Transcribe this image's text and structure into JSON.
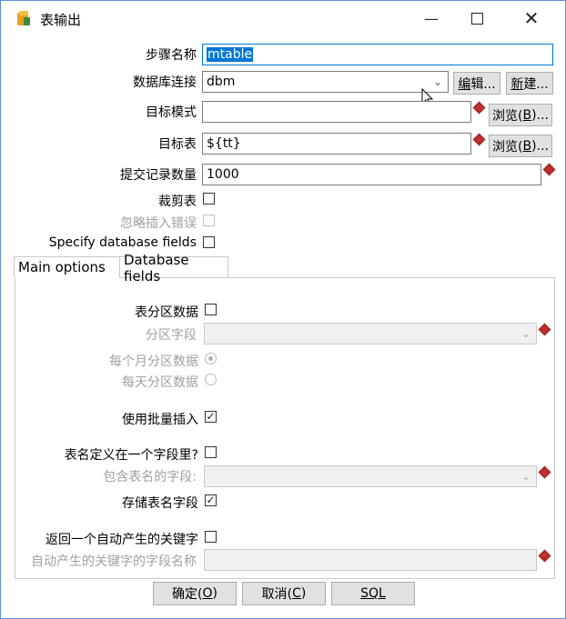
{
  "window": {
    "title": "表输出"
  },
  "fields": {
    "step_name": {
      "label": "步骤名称",
      "value": "mtable"
    },
    "db_conn": {
      "label": "数据库连接",
      "value": "dbm",
      "edit": "编辑...",
      "edit_u": "编",
      "edit_rest": "辑...",
      "new": "新建...",
      "new_u": "新",
      "new_rest": "建..."
    },
    "target_schema": {
      "label": "目标模式",
      "value": "",
      "browse_pre": "浏览(",
      "browse_u": "B",
      "browse_post": ")..."
    },
    "target_table": {
      "label": "目标表",
      "value": "${tt}",
      "browse_pre": "浏览(",
      "browse_u": "B",
      "browse_post": ")..."
    },
    "commit_size": {
      "label": "提交记录数量",
      "value": "1000"
    },
    "truncate": {
      "label": "裁剪表",
      "checked": false
    },
    "ignore_errors": {
      "label": "忽略插入错误",
      "checked": false
    },
    "specify_fields": {
      "label": "Specify database fields",
      "checked": false
    }
  },
  "tabs": [
    {
      "label": "Main options",
      "active": true
    },
    {
      "label": "Database fields",
      "active": false
    }
  ],
  "main_options": {
    "partition": {
      "label": "表分区数据",
      "checked": false
    },
    "partition_field": {
      "label": "分区字段",
      "value": ""
    },
    "monthly": {
      "label": "每个月分区数据",
      "selected": true
    },
    "daily": {
      "label": "每天分区数据",
      "selected": false
    },
    "batch": {
      "label": "使用批量插入",
      "checked": true
    },
    "name_in_field": {
      "label": "表名定义在一个字段里?",
      "checked": false
    },
    "name_field": {
      "label": "包含表名的字段:",
      "value": ""
    },
    "store_name": {
      "label": "存储表名字段",
      "checked": true
    },
    "return_key": {
      "label": "返回一个自动产生的关键字",
      "checked": false
    },
    "key_field": {
      "label": "自动产生的关键字的字段名称",
      "value": ""
    }
  },
  "footer": {
    "ok_pre": "确定(",
    "ok_u": "O",
    "ok_post": ")",
    "cancel_pre": "取消(",
    "cancel_u": "C",
    "cancel_post": ")",
    "sql": "SQL"
  },
  "icons": {
    "minimize": "minimize-icon",
    "maximize": "maximize-icon",
    "close": "close-icon"
  },
  "colors": {
    "accent": "#0078d7",
    "required_marker": "#c0302c"
  }
}
